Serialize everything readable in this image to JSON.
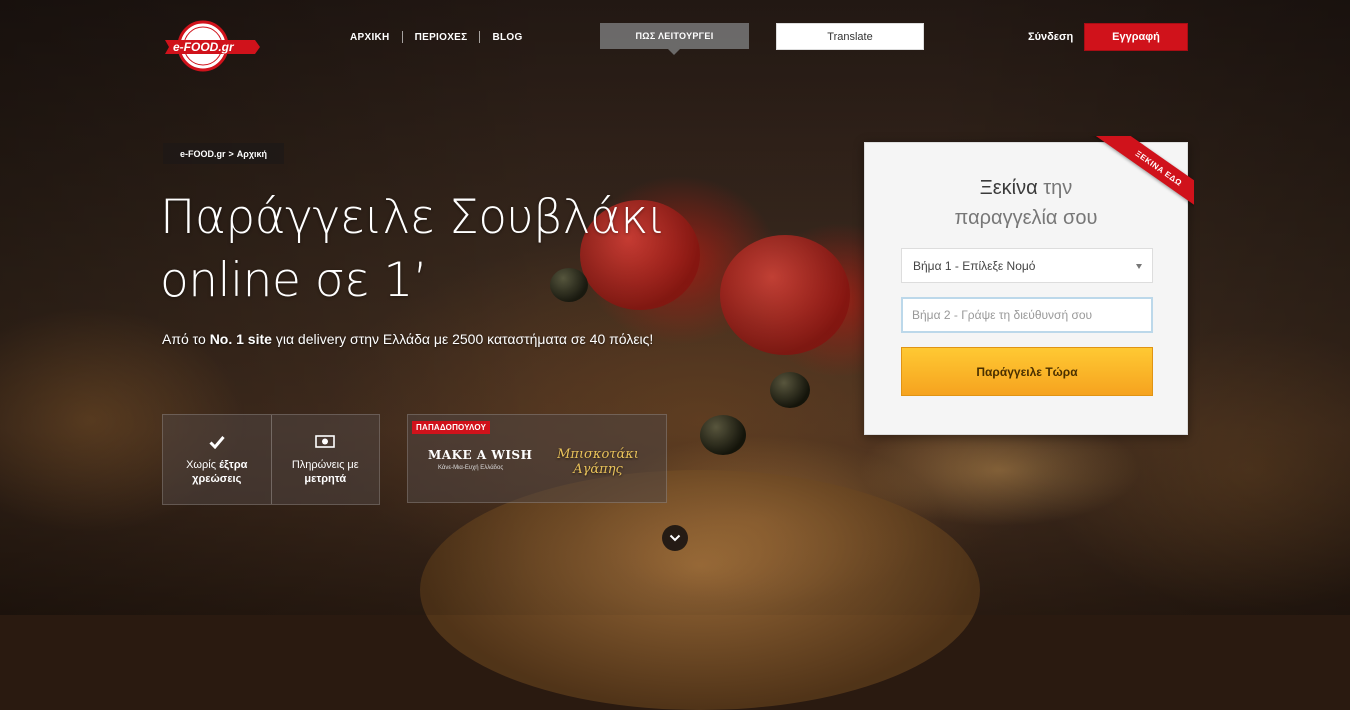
{
  "header": {
    "logo_text": "e-FOOD.gr",
    "nav": [
      {
        "label": "ΑΡΧΙΚΗ"
      },
      {
        "label": "ΠΕΡΙΟΧΕΣ"
      },
      {
        "label": "BLOG"
      }
    ],
    "how_it_works": "ΠΩΣ ΛΕΙΤΟΥΡΓΕΙ",
    "translate": "Translate",
    "login": "Σύνδεση",
    "register": "Εγγραφή",
    "brand_color": "#d0121b"
  },
  "breadcrumb": {
    "home": "e-FOOD.gr",
    "separator": ">",
    "current": "Αρχική"
  },
  "hero": {
    "headline_line1": "Παράγγειλε Σουβλάκι",
    "headline_line2": "online σε 1’",
    "sub_prefix": "Από το ",
    "sub_bold": "No. 1 site",
    "sub_suffix": " για delivery στην Ελλάδα με 2500 καταστήματα σε 40 πόλεις!"
  },
  "features": [
    {
      "icon": "check-icon",
      "line1": "Χωρίς ",
      "line1_bold": "έξτρα",
      "line2_bold": "χρεώσεις"
    },
    {
      "icon": "cash-icon",
      "line1": "Πληρώνεις με",
      "line2_bold": "μετρητά"
    }
  ],
  "sponsor": {
    "brand": "ΠΑΠΑΔΟΠΟΥΛΟΥ",
    "wish": "MAKE A WISH",
    "wish_sub": "Κάνε-Μια-Ευχή Ελλάδος",
    "product_line1": "Μπισκοτάκι",
    "product_line2": "Αγάπης"
  },
  "order_card": {
    "ribbon": "ΞΕΚΙΝΑ ΕΔΩ",
    "title_strong": "Ξεκίνα",
    "title_rest": " την",
    "title_line2": "παραγγελία σου",
    "step1": "Βήμα 1 - Επίλεξε Νομό",
    "step2_placeholder": "Βήμα 2 - Γράψε τη διεύθυνσή σου",
    "order_button": "Παράγγειλε Τώρα"
  }
}
